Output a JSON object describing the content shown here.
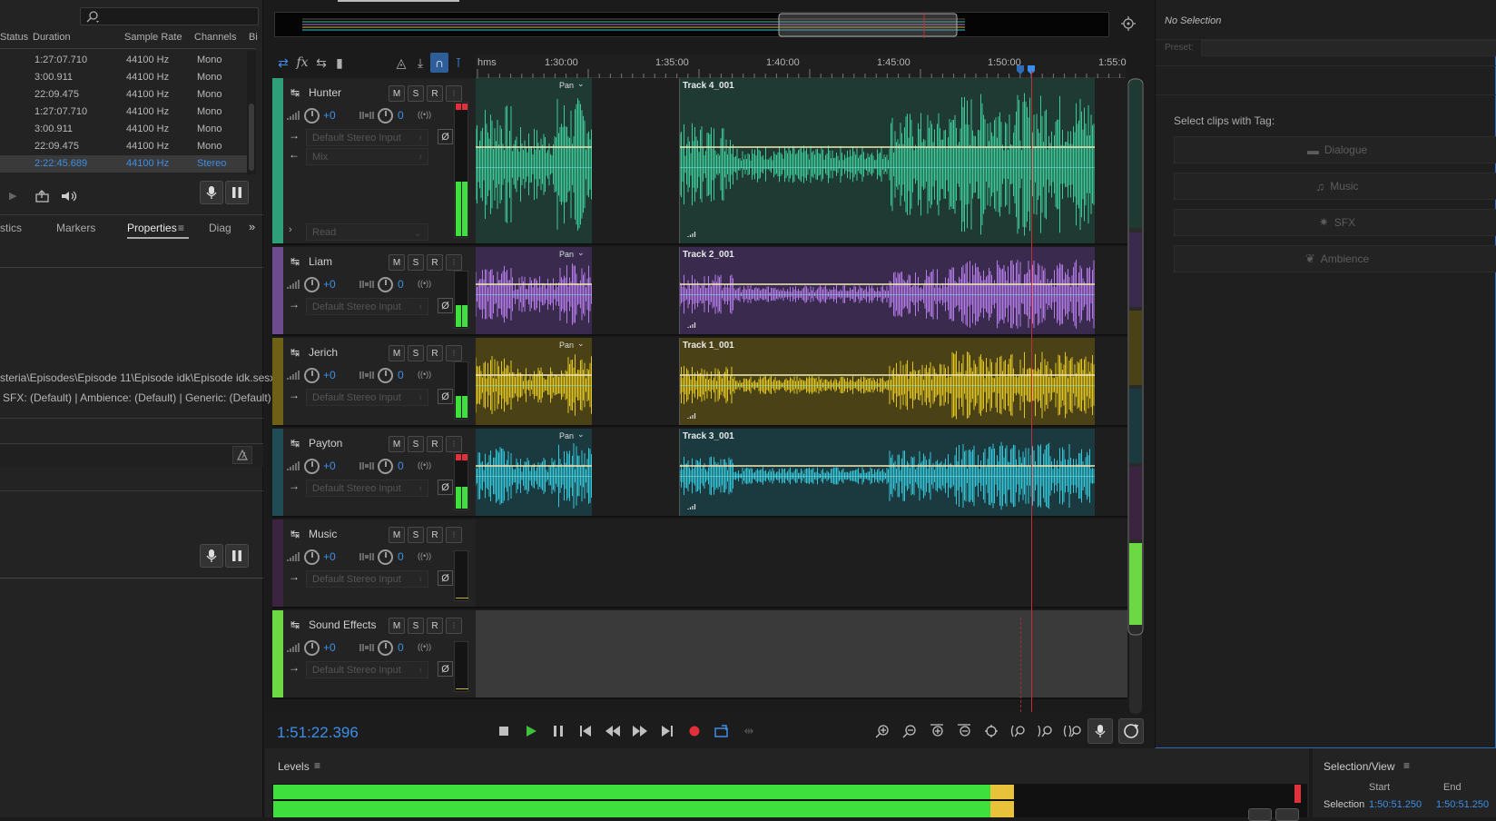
{
  "files": {
    "columns": [
      "Status",
      "Duration",
      "Sample Rate",
      "Channels",
      "Bi"
    ],
    "rows": [
      {
        "duration": "1:27:07.710",
        "rate": "44100 Hz",
        "channels": "Mono",
        "selected": false
      },
      {
        "duration": "3:00.911",
        "rate": "44100 Hz",
        "channels": "Mono",
        "selected": false
      },
      {
        "duration": "22:09.475",
        "rate": "44100 Hz",
        "channels": "Mono",
        "selected": false
      },
      {
        "duration": "1:27:07.710",
        "rate": "44100 Hz",
        "channels": "Mono",
        "selected": false
      },
      {
        "duration": "3:00.911",
        "rate": "44100 Hz",
        "channels": "Mono",
        "selected": false
      },
      {
        "duration": "22:09.475",
        "rate": "44100 Hz",
        "channels": "Mono",
        "selected": false
      },
      {
        "duration": "2:22:45.689",
        "rate": "44100 Hz",
        "channels": "Stereo",
        "selected": true
      }
    ]
  },
  "props_tabs": {
    "t1": "stics",
    "t2": "Markers",
    "t3": "Properties",
    "t4": "Diag"
  },
  "props": {
    "path": "steria\\Episodes\\Episode 11\\Episode idk\\Episode idk.sesx",
    "tags": "SFX: (Default) | Ambience: (Default) | Generic: (Default)"
  },
  "ruler": {
    "labels": [
      "hms",
      "1:30:00",
      "1:35:00",
      "1:40:00",
      "1:45:00",
      "1:50:00",
      "1:55:0"
    ]
  },
  "tracks": [
    {
      "name": "Hunter",
      "clip": "Track 4_001",
      "color": "#2f9f7a",
      "wave": "#3ec99a",
      "bg": "#1f3a33",
      "vol": "+0",
      "pan": "0",
      "input": "Default Stereo Input",
      "mix": "Mix",
      "read": "Read"
    },
    {
      "name": "Liam",
      "clip": "Track 2_001",
      "color": "#6c4b8f",
      "wave": "#b37be8",
      "bg": "#3a2b4e",
      "vol": "+0",
      "pan": "0",
      "input": "Default Stereo Input"
    },
    {
      "name": "Jerich",
      "clip": "Track 1_001",
      "color": "#6e6014",
      "wave": "#e2c523",
      "bg": "#4a4216",
      "vol": "+0",
      "pan": "0",
      "input": "Default Stereo Input"
    },
    {
      "name": "Payton",
      "clip": "Track 3_001",
      "color": "#1f4c55",
      "wave": "#34c6d8",
      "bg": "#1a3a40",
      "vol": "+0",
      "pan": "0",
      "input": "Default Stereo Input"
    },
    {
      "name": "Music",
      "vol": "+0",
      "pan": "0",
      "input": "Default Stereo Input"
    },
    {
      "name": "Sound Effects",
      "vol": "+0",
      "pan": "0",
      "input": "Default Stereo Input"
    }
  ],
  "pan_label": "Pan",
  "timecode": "1:51:22.396",
  "essential": {
    "title": "No Selection",
    "preset": "Preset:",
    "select_tag": "Select clips with Tag:",
    "tags": [
      "Dialogue",
      "Music",
      "SFX",
      "Ambience"
    ]
  },
  "levels": {
    "title": "Levels"
  },
  "selview": {
    "title": "Selection/View",
    "start": "Start",
    "end": "End",
    "row": "Selection",
    "start_val": "1:50:51.250",
    "end_val": "1:50:51.250"
  },
  "colors": {
    "accent": "#3d8ee8",
    "record": "#e0303a",
    "play": "#3fc03f",
    "meter_green": "#3de03d",
    "meter_yellow": "#e8c23a"
  }
}
